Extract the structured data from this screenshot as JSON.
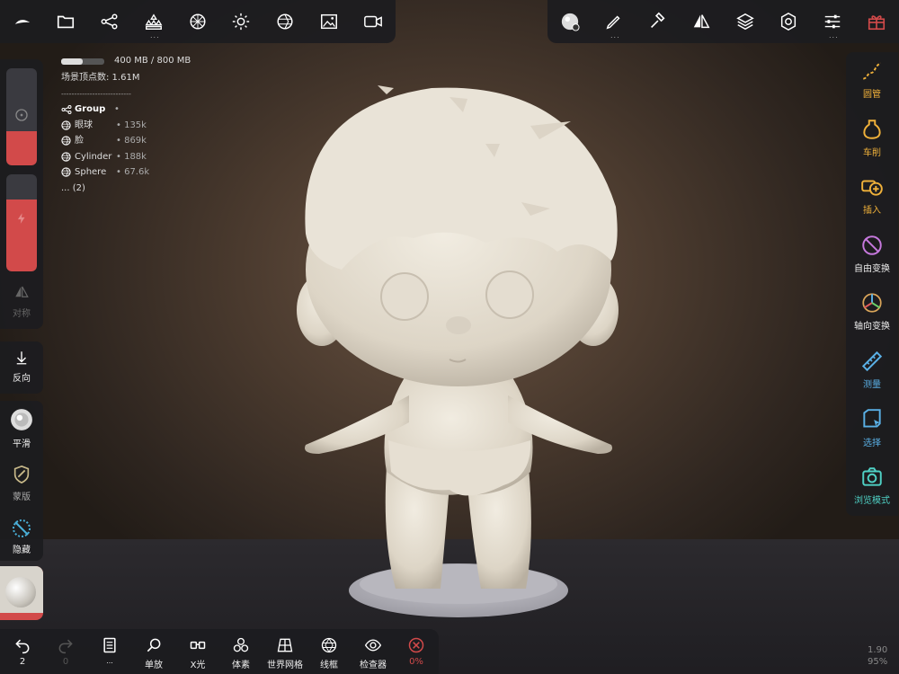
{
  "top_left_toolbar": {
    "items": [
      {
        "icon": "logo-icon"
      },
      {
        "icon": "folder-icon"
      },
      {
        "icon": "scene-graph-icon"
      },
      {
        "icon": "primitives-icon",
        "more": "..."
      },
      {
        "icon": "sphere-grid-icon"
      },
      {
        "icon": "light-icon"
      },
      {
        "icon": "material-icon"
      },
      {
        "icon": "image-icon"
      },
      {
        "icon": "video-icon"
      }
    ]
  },
  "top_right_toolbar": {
    "items": [
      {
        "icon": "matcap-sphere-icon"
      },
      {
        "icon": "brush-icon",
        "more": "..."
      },
      {
        "icon": "hammer-icon"
      },
      {
        "icon": "symmetry-icon"
      },
      {
        "icon": "layers-icon"
      },
      {
        "icon": "settings-icon"
      },
      {
        "icon": "sliders-icon",
        "more": "..."
      },
      {
        "icon": "gift-icon"
      }
    ]
  },
  "scene_info": {
    "memory": "400 MB / 800 MB",
    "memory_fraction": 0.5,
    "vertices": "场景顶点数: 1.61M",
    "separator": "---------------------------",
    "group": {
      "name": "Group",
      "marker": "•"
    },
    "objects": [
      {
        "name": "眼球",
        "count": "• 135k"
      },
      {
        "name": "脸",
        "count": "• 869k"
      },
      {
        "name": "Cylinder",
        "count": "• 188k"
      },
      {
        "name": "Sphere",
        "count": "• 67.6k"
      }
    ],
    "more": "... (2)"
  },
  "left_panel": {
    "symmetry_label": "对称",
    "reverse_label": "反向",
    "smooth_label": "平滑",
    "mask_label": "蒙版",
    "hide_label": "隐藏"
  },
  "right_panel": {
    "items": [
      {
        "label": "圆管",
        "icon": "tube-icon"
      },
      {
        "label": "车削",
        "icon": "lathe-icon"
      },
      {
        "label": "插入",
        "icon": "insert-icon"
      },
      {
        "label": "自由变换",
        "icon": "free-transform-icon"
      },
      {
        "label": "轴向变换",
        "icon": "axis-transform-icon"
      },
      {
        "label": "测量",
        "icon": "ruler-icon"
      },
      {
        "label": "选择",
        "icon": "select-icon"
      },
      {
        "label": "浏览模式",
        "icon": "camera-icon"
      }
    ]
  },
  "bottom_toolbar": {
    "undo_count": "2",
    "redo_count": "0",
    "doc_more": "...",
    "items": [
      {
        "label": "单放",
        "icon": "zoom-icon"
      },
      {
        "label": "X光",
        "icon": "xray-icon"
      },
      {
        "label": "体素",
        "icon": "voxel-icon"
      },
      {
        "label": "世界网格",
        "icon": "world-grid-icon"
      },
      {
        "label": "线框",
        "icon": "wireframe-icon"
      },
      {
        "label": "检查器",
        "icon": "inspector-icon"
      },
      {
        "label": "0%",
        "icon": "close-circle-icon"
      }
    ]
  },
  "status": {
    "fps": "1.90",
    "zoom": "95%"
  },
  "colors": {
    "accent": "#f0b13a",
    "teal": "#4fd1c5",
    "red": "#d24a4a",
    "panel": "#1c1c20"
  }
}
